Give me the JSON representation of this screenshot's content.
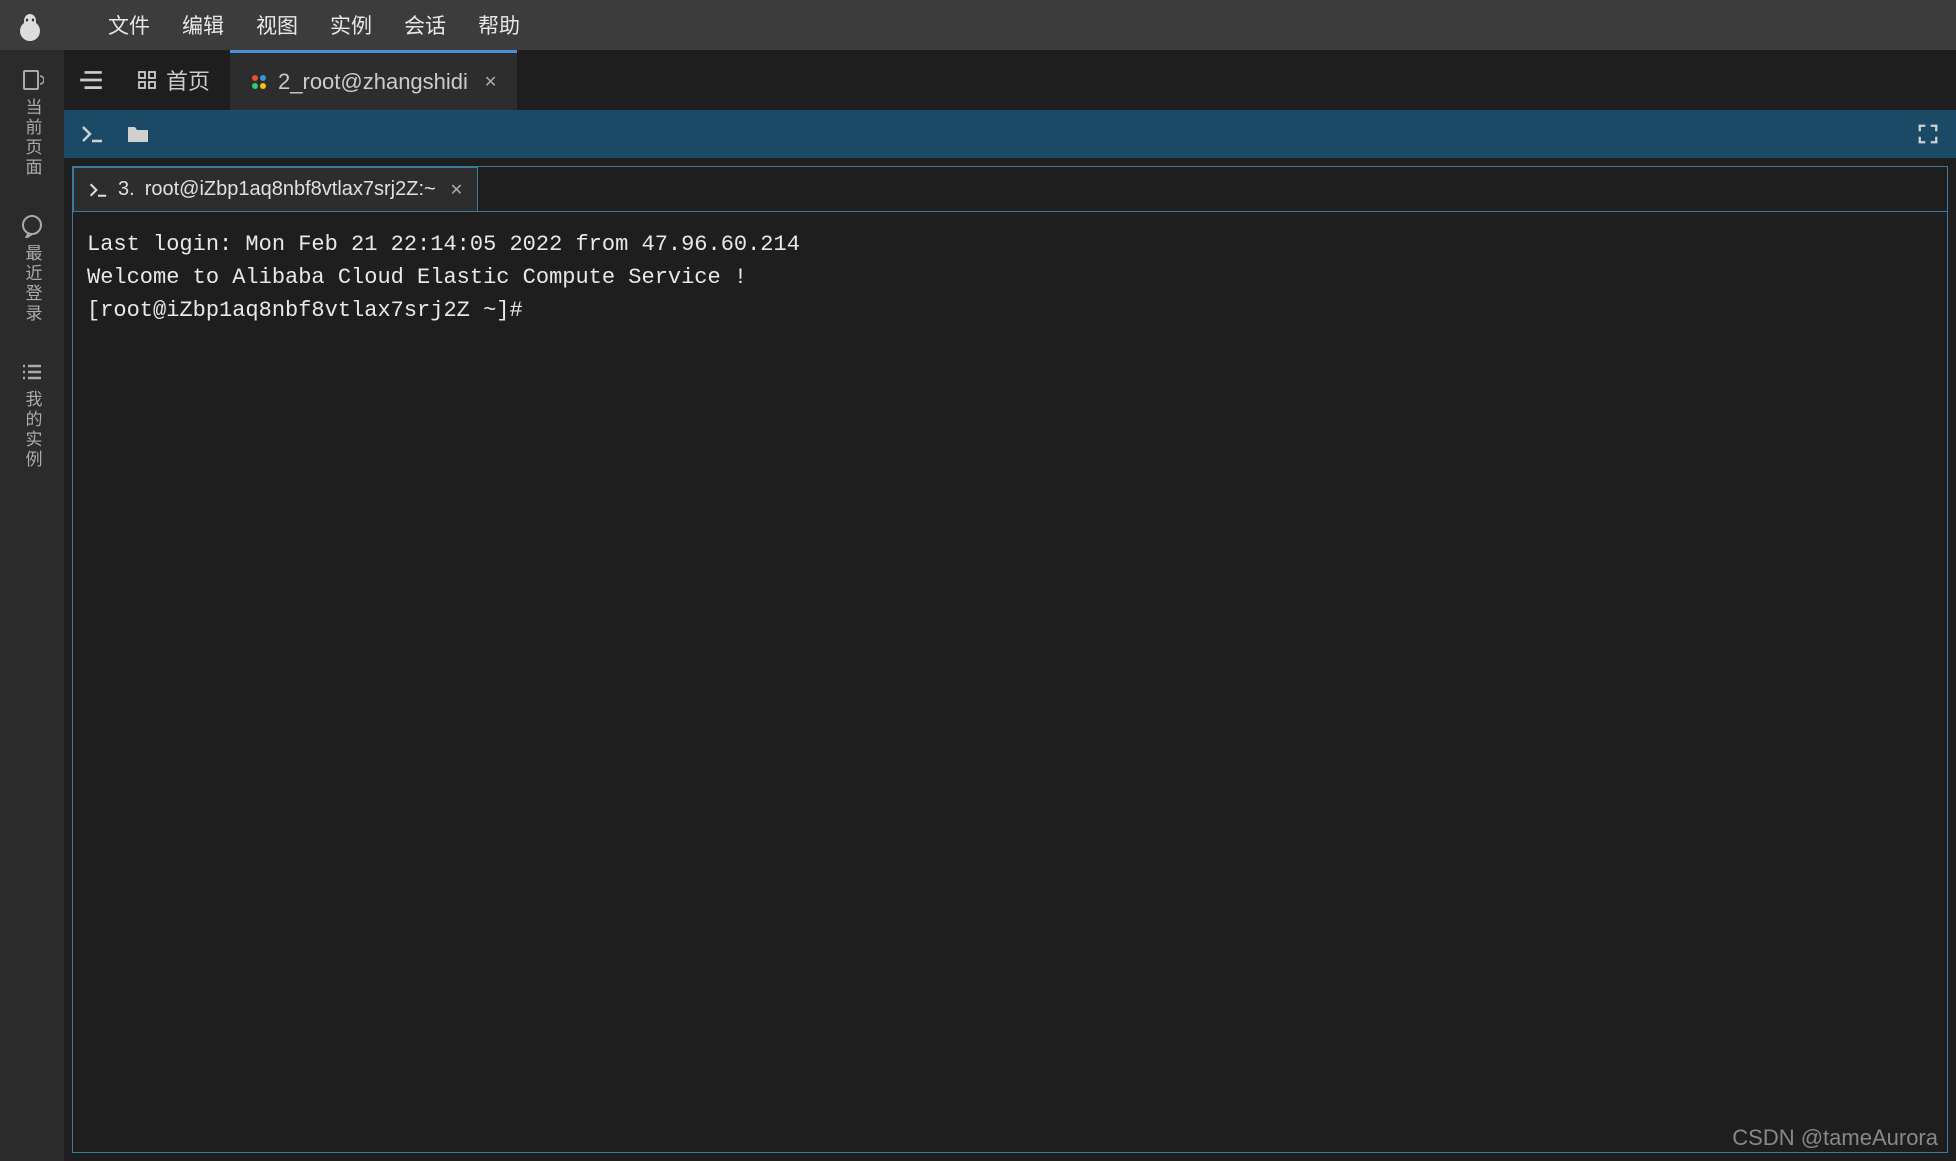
{
  "menu": {
    "items": [
      "文件",
      "编辑",
      "视图",
      "实例",
      "会话",
      "帮助"
    ]
  },
  "sidebar": {
    "items": [
      {
        "label": "当前页面",
        "icon": "page-reload-icon"
      },
      {
        "label": "最近登录",
        "icon": "chat-icon"
      },
      {
        "label": "我的实例",
        "icon": "list-icon"
      }
    ]
  },
  "topTabs": [
    {
      "label": "首页",
      "icon": "grid-icon",
      "active": false,
      "closable": false
    },
    {
      "label": "2_root@zhangshidi",
      "icon": "color-dots-icon",
      "active": true,
      "closable": true
    }
  ],
  "innerTab": {
    "number": "3.",
    "label": "root@iZbp1aq8nbf8vtlax7srj2Z:~"
  },
  "terminal": {
    "lines": [
      "Last login: Mon Feb 21 22:14:05 2022 from 47.96.60.214",
      "",
      "Welcome to Alibaba Cloud Elastic Compute Service !",
      "",
      "[root@iZbp1aq8nbf8vtlax7srj2Z ~]# "
    ]
  },
  "watermark": "CSDN @tameAurora"
}
